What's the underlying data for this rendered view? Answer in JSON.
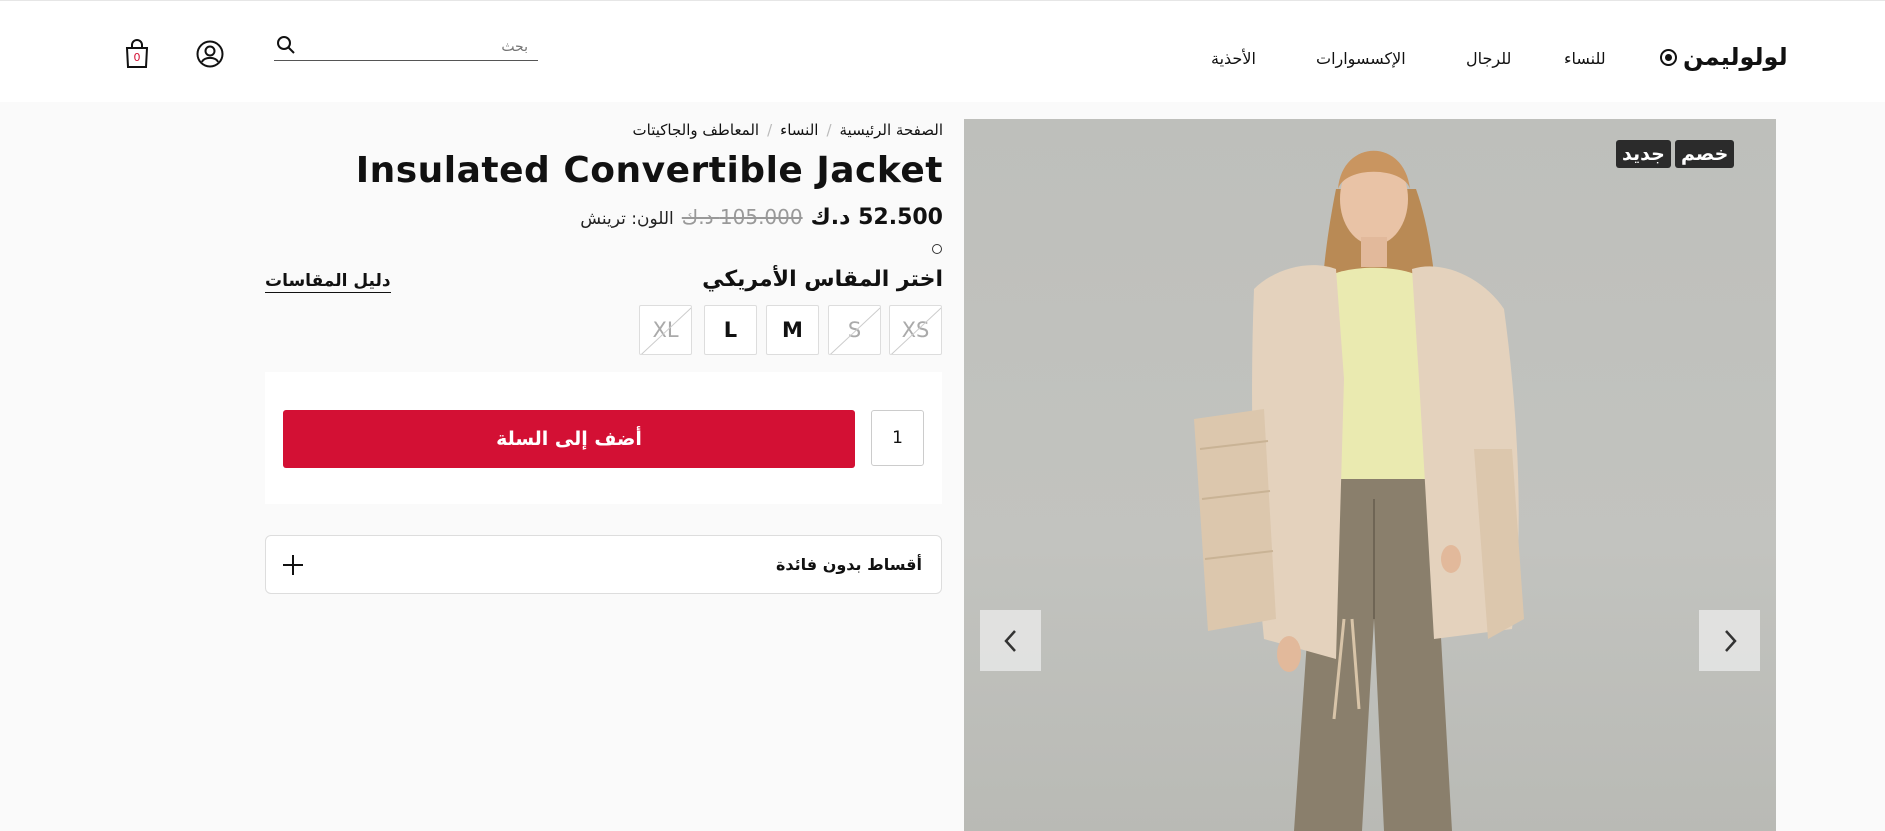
{
  "header": {
    "brand": "لولوليمن",
    "nav": [
      "للنساء",
      "للرجال",
      "الإكسسوارات",
      "الأحذية"
    ],
    "search_placeholder": "بحث",
    "cart_count": "0"
  },
  "breadcrumb": [
    "الصفحة الرئيسية",
    "النساء",
    "المعاطف والجاكيتات"
  ],
  "product": {
    "title": "Insulated Convertible Jacket",
    "price": "52.500 د.ك",
    "old_price": "105.000 د.ك",
    "color_label": "اللون: ترينش",
    "size_heading": "اختر المقاس الأمريكي",
    "size_guide": "دليل المقاسات",
    "sizes": [
      {
        "label": "XS",
        "available": false
      },
      {
        "label": "S",
        "available": false
      },
      {
        "label": "M",
        "available": true
      },
      {
        "label": "L",
        "available": true
      },
      {
        "label": "XL",
        "available": false
      }
    ],
    "quantity": "1",
    "add_to_cart": "أضف إلى السلة",
    "installments": "أقساط بدون فائدة"
  },
  "gallery": {
    "badges": [
      "خصم",
      "جديد"
    ]
  },
  "colors": {
    "accent": "#d31034",
    "badge_bg": "#2b2b2b",
    "jacket": "#e4d2bd",
    "top": "#eaeab0",
    "pants": "#8a7f6c"
  }
}
